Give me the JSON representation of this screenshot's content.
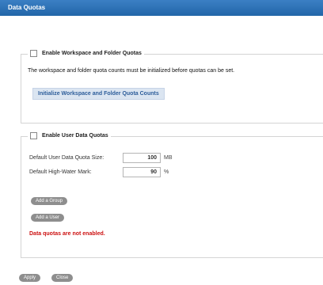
{
  "window": {
    "title": "Data Quotas"
  },
  "workspace_quota": {
    "checkbox_label": "Enable Workspace and Folder Quotas",
    "checked": false,
    "notice": "The workspace and folder quota counts must be initialized before quotas can be set.",
    "init_button_label": "Initialize Workspace and Folder Quota Counts"
  },
  "user_quota": {
    "checkbox_label": "Enable User Data Quotas",
    "checked": false,
    "default_size": {
      "label": "Default User Data Quota Size:",
      "value": "100",
      "unit": "MB"
    },
    "high_water": {
      "label": "Default High-Water Mark:",
      "value": "90",
      "unit": "%"
    },
    "add_group_label": "Add a Group",
    "add_user_label": "Add a User",
    "error_text": "Data quotas are not enabled."
  },
  "footer": {
    "apply_label": "Apply",
    "close_label": "Close"
  },
  "colors": {
    "titlebar": "#2b6fb3",
    "button_pill": "#8e8e8e",
    "error": "#cc1111",
    "link_button_bg": "#dbe5f1"
  }
}
